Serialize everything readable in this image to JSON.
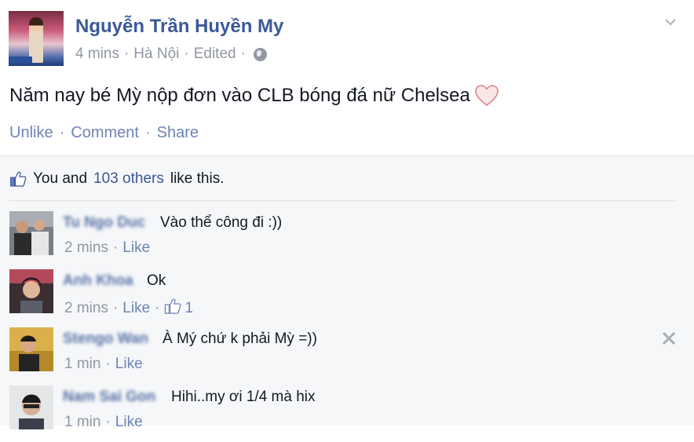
{
  "post": {
    "author": "Nguyễn Trần Huyền My",
    "time": "4 mins",
    "location": "Hà Nội",
    "edited": "Edited",
    "text": "Năm nay bé Mỳ nộp đơn vào CLB bóng đá nữ Chelsea",
    "emoji": "heart-icon",
    "actions": {
      "unlike": "Unlike",
      "comment": "Comment",
      "share": "Share"
    }
  },
  "likes": {
    "prefix": "You and",
    "others": "103 others",
    "suffix": "like this."
  },
  "comments": [
    {
      "name": "Tu Ngo Duc",
      "text": "Vào thể công đi :))",
      "time": "2 mins",
      "like": "Like"
    },
    {
      "name": "Anh Khoa",
      "text": "Ok",
      "time": "2 mins",
      "like": "Like",
      "like_count": "1"
    },
    {
      "name": "Stengo Wan",
      "text": "À Mý chứ k phải Mỳ =))",
      "time": "1 min",
      "like": "Like"
    },
    {
      "name": "Nam Sai Gon",
      "text": "Hihi..my ơi 1/4 mà hix",
      "time": "1 min",
      "like": "Like"
    }
  ],
  "colors": {
    "link": "#3b5998",
    "action": "#6d84b4",
    "meta": "#9197a3",
    "ufi_bg": "#f6f7f9"
  }
}
